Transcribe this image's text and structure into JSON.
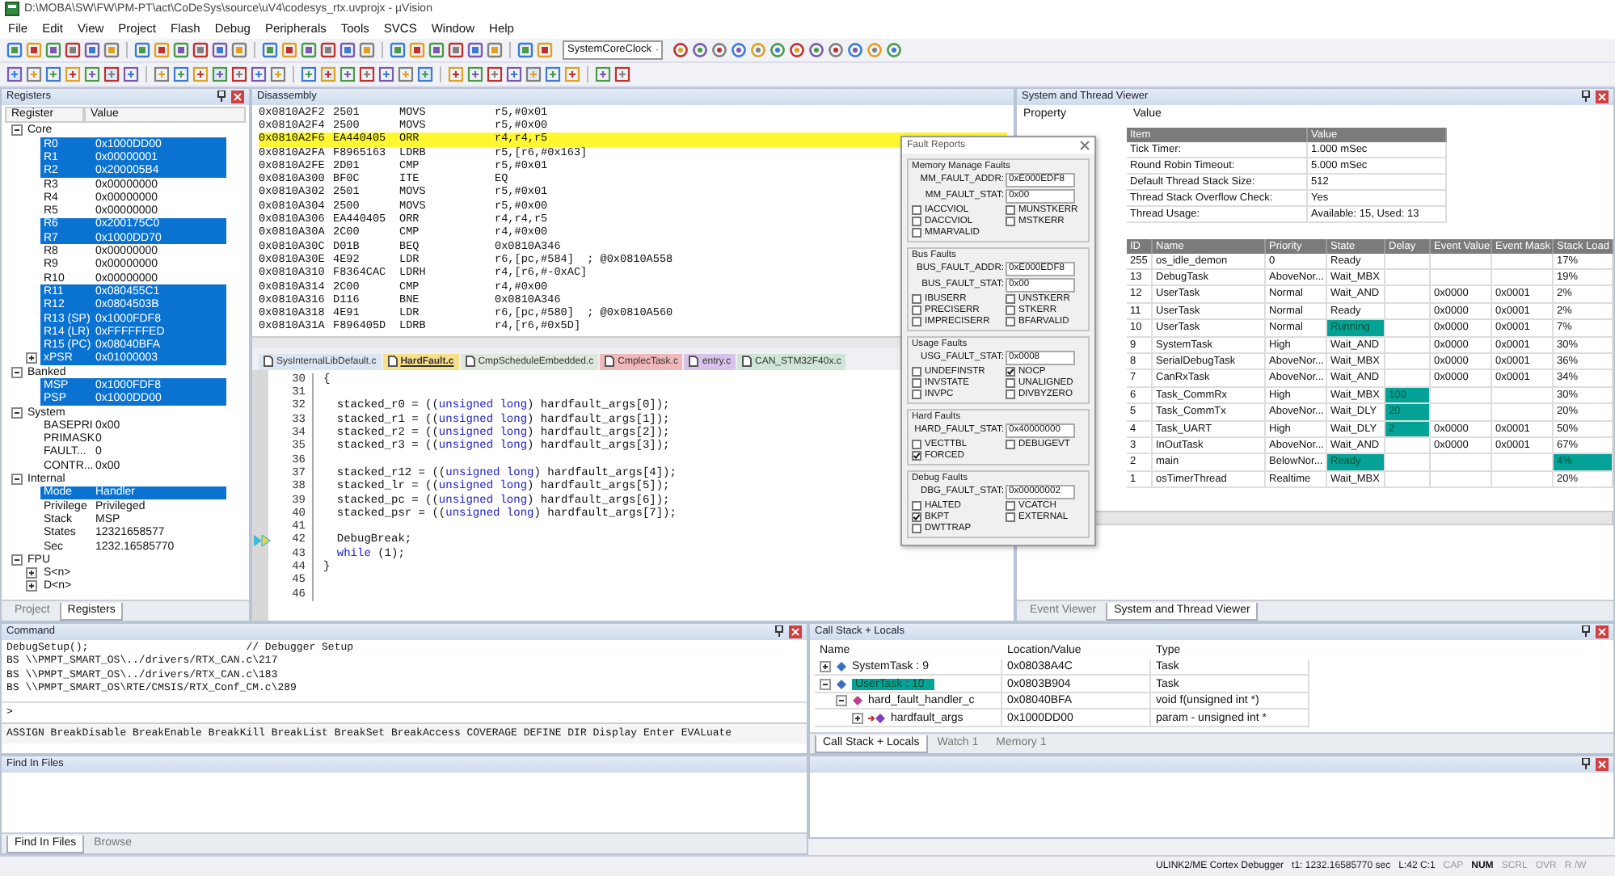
{
  "window": {
    "title": "D:\\MOBA\\SW\\FW\\PM-PT\\act\\CoDeSys\\source\\uV4\\codesys_rtx.uvprojx - µVision"
  },
  "menu": [
    "File",
    "Edit",
    "View",
    "Project",
    "Flash",
    "Debug",
    "Peripherals",
    "Tools",
    "SVCS",
    "Window",
    "Help"
  ],
  "toolbar": {
    "dropdown": "SystemCoreClock"
  },
  "registers": {
    "title": "Registers",
    "columns": [
      "Register",
      "Value"
    ],
    "groups": [
      {
        "name": "Core",
        "expanded": true,
        "items": [
          {
            "name": "R0",
            "value": "0x1000DD00",
            "highlighted": true
          },
          {
            "name": "R1",
            "value": "0x00000001",
            "highlighted": true
          },
          {
            "name": "R2",
            "value": "0x200005B4",
            "highlighted": true
          },
          {
            "name": "R3",
            "value": "0x00000000",
            "highlighted": false
          },
          {
            "name": "R4",
            "value": "0x00000000",
            "highlighted": false
          },
          {
            "name": "R5",
            "value": "0x00000000",
            "highlighted": false
          },
          {
            "name": "R6",
            "value": "0x200175C0",
            "highlighted": true
          },
          {
            "name": "R7",
            "value": "0x1000DD70",
            "highlighted": true
          },
          {
            "name": "R8",
            "value": "0x00000000",
            "highlighted": false
          },
          {
            "name": "R9",
            "value": "0x00000000",
            "highlighted": false
          },
          {
            "name": "R10",
            "value": "0x00000000",
            "highlighted": false
          },
          {
            "name": "R11",
            "value": "0x080455C1",
            "highlighted": true
          },
          {
            "name": "R12",
            "value": "0x0804503B",
            "highlighted": true
          },
          {
            "name": "R13 (SP)",
            "value": "0x1000FDF8",
            "highlighted": true
          },
          {
            "name": "R14 (LR)",
            "value": "0xFFFFFFED",
            "highlighted": true
          },
          {
            "name": "R15 (PC)",
            "value": "0x08040BFA",
            "highlighted": true
          },
          {
            "name": "xPSR",
            "value": "0x01000003",
            "highlighted": true,
            "expanded": false
          }
        ]
      },
      {
        "name": "Banked",
        "expanded": true,
        "items": [
          {
            "name": "MSP",
            "value": "0x1000FDF8",
            "highlighted": true
          },
          {
            "name": "PSP",
            "value": "0x1000DD00",
            "highlighted": true
          }
        ]
      },
      {
        "name": "System",
        "expanded": true,
        "items": [
          {
            "name": "BASEPRI",
            "value": "0x00",
            "highlighted": false
          },
          {
            "name": "PRIMASK",
            "value": "0",
            "highlighted": false
          },
          {
            "name": "FAULT...",
            "value": "0",
            "highlighted": false
          },
          {
            "name": "CONTR...",
            "value": "0x00",
            "highlighted": false
          }
        ]
      },
      {
        "name": "Internal",
        "expanded": true,
        "items": [
          {
            "name": "Mode",
            "value": "Handler",
            "highlighted": true
          },
          {
            "name": "Privilege",
            "value": "Privileged",
            "highlighted": false
          },
          {
            "name": "Stack",
            "value": "MSP",
            "highlighted": false
          },
          {
            "name": "States",
            "value": "12321658577",
            "highlighted": false
          },
          {
            "name": "Sec",
            "value": "1232.16585770",
            "highlighted": false
          }
        ]
      },
      {
        "name": "FPU",
        "expanded": true,
        "items": [
          {
            "name": "S<n>",
            "highlighted": false,
            "expanded": false
          },
          {
            "name": "D<n>",
            "highlighted": false,
            "expanded": false
          }
        ]
      }
    ],
    "tabs": [
      {
        "label": "Project",
        "selected": false
      },
      {
        "label": "Registers",
        "selected": true
      }
    ]
  },
  "disassembly": {
    "title": "Disassembly",
    "rows": [
      {
        "address": "0x0810A2F2",
        "opcode": "2501",
        "mnemonic": "MOVS",
        "operands": "r5,#0x01",
        "current": false
      },
      {
        "address": "0x0810A2F4",
        "opcode": "2500",
        "mnemonic": "MOVS",
        "operands": "r5,#0x00",
        "current": false
      },
      {
        "address": "0x0810A2F6",
        "opcode": "EA440405",
        "mnemonic": "ORR",
        "operands": "r4,r4,r5",
        "current": true
      },
      {
        "address": "0x0810A2FA",
        "opcode": "F8965163",
        "mnemonic": "LDRB",
        "operands": "r5,[r6,#0x163]",
        "current": false
      },
      {
        "address": "0x0810A2FE",
        "opcode": "2D01",
        "mnemonic": "CMP",
        "operands": "r5,#0x01",
        "current": false
      },
      {
        "address": "0x0810A300",
        "opcode": "BF0C",
        "mnemonic": "ITE",
        "operands": "EQ",
        "current": false
      },
      {
        "address": "0x0810A302",
        "opcode": "2501",
        "mnemonic": "MOVS",
        "operands": "r5,#0x01",
        "current": false
      },
      {
        "address": "0x0810A304",
        "opcode": "2500",
        "mnemonic": "MOVS",
        "operands": "r5,#0x00",
        "current": false
      },
      {
        "address": "0x0810A306",
        "opcode": "EA440405",
        "mnemonic": "ORR",
        "operands": "r4,r4,r5",
        "current": false
      },
      {
        "address": "0x0810A30A",
        "opcode": "2C00",
        "mnemonic": "CMP",
        "operands": "r4,#0x00",
        "current": false
      },
      {
        "address": "0x0810A30C",
        "opcode": "D01B",
        "mnemonic": "BEQ",
        "operands": "0x0810A346",
        "current": false
      },
      {
        "address": "0x0810A30E",
        "opcode": "4E92",
        "mnemonic": "LDR",
        "operands": "r6,[pc,#584]  ; @0x0810A558",
        "current": false
      },
      {
        "address": "0x0810A310",
        "opcode": "F8364CAC",
        "mnemonic": "LDRH",
        "operands": "r4,[r6,#-0xAC]",
        "current": false
      },
      {
        "address": "0x0810A314",
        "opcode": "2C00",
        "mnemonic": "CMP",
        "operands": "r4,#0x00",
        "current": false
      },
      {
        "address": "0x0810A316",
        "opcode": "D116",
        "mnemonic": "BNE",
        "operands": "0x0810A346",
        "current": false
      },
      {
        "address": "0x0810A318",
        "opcode": "4E91",
        "mnemonic": "LDR",
        "operands": "r6,[pc,#580]  ; @0x0810A560",
        "current": false
      },
      {
        "address": "0x0810A31A",
        "opcode": "F896405D",
        "mnemonic": "LDRB",
        "operands": "r4,[r6,#0x5D]",
        "current": false
      }
    ]
  },
  "editor": {
    "tabs": [
      {
        "label": "SysInternalLibDefault.c",
        "selected": false,
        "color": "#dce6f2"
      },
      {
        "label": "HardFault.c",
        "selected": true,
        "color": "#f7e08a"
      },
      {
        "label": "CmpScheduleEmbedded.c",
        "selected": false,
        "color": "#dfe8dc"
      },
      {
        "label": "CmplecTask.c",
        "selected": false,
        "color": "#f2b8b8"
      },
      {
        "label": "entry.c",
        "selected": false,
        "color": "#d7c3ea"
      },
      {
        "label": "CAN_STM32F40x.c",
        "selected": false,
        "color": "#cfe5d6"
      }
    ],
    "lines": [
      {
        "number": "30",
        "current": false,
        "parts": [
          {
            "text": "{",
            "kind": "plain"
          }
        ]
      },
      {
        "number": "31",
        "current": false
      },
      {
        "number": "32",
        "current": false,
        "parts": [
          {
            "text": "  stacked_r0 = ((",
            "kind": "plain"
          },
          {
            "text": "unsigned long",
            "kind": "keyword"
          },
          {
            "text": ") hardfault_args[0]);",
            "kind": "plain"
          }
        ]
      },
      {
        "number": "33",
        "current": false,
        "parts": [
          {
            "text": "  stacked_r1 = ((",
            "kind": "plain"
          },
          {
            "text": "unsigned long",
            "kind": "keyword"
          },
          {
            "text": ") hardfault_args[1]);",
            "kind": "plain"
          }
        ]
      },
      {
        "number": "34",
        "current": false,
        "parts": [
          {
            "text": "  stacked_r2 = ((",
            "kind": "plain"
          },
          {
            "text": "unsigned long",
            "kind": "keyword"
          },
          {
            "text": ") hardfault_args[2]);",
            "kind": "plain"
          }
        ]
      },
      {
        "number": "35",
        "current": false,
        "parts": [
          {
            "text": "  stacked_r3 = ((",
            "kind": "plain"
          },
          {
            "text": "unsigned long",
            "kind": "keyword"
          },
          {
            "text": ") hardfault_args[3]);",
            "kind": "plain"
          }
        ]
      },
      {
        "number": "36",
        "current": false
      },
      {
        "number": "37",
        "current": false,
        "parts": [
          {
            "text": "  stacked_r12 = ((",
            "kind": "plain"
          },
          {
            "text": "unsigned long",
            "kind": "keyword"
          },
          {
            "text": ") hardfault_args[4]);",
            "kind": "plain"
          }
        ]
      },
      {
        "number": "38",
        "current": false,
        "parts": [
          {
            "text": "  stacked_lr = ((",
            "kind": "plain"
          },
          {
            "text": "unsigned long",
            "kind": "keyword"
          },
          {
            "text": ") hardfault_args[5]);",
            "kind": "plain"
          }
        ]
      },
      {
        "number": "39",
        "current": false,
        "parts": [
          {
            "text": "  stacked_pc = ((",
            "kind": "plain"
          },
          {
            "text": "unsigned long",
            "kind": "keyword"
          },
          {
            "text": ") hardfault_args[6]);",
            "kind": "plain"
          }
        ]
      },
      {
        "number": "40",
        "current": false,
        "parts": [
          {
            "text": "  stacked_psr = ((",
            "kind": "plain"
          },
          {
            "text": "unsigned long",
            "kind": "keyword"
          },
          {
            "text": ") hardfault_args[7]);",
            "kind": "plain"
          }
        ]
      },
      {
        "number": "41",
        "current": false
      },
      {
        "number": "42",
        "current": true,
        "parts": [
          {
            "text": "  DebugBreak;",
            "kind": "plain"
          }
        ]
      },
      {
        "number": "43",
        "current": false,
        "parts": [
          {
            "text": "  while",
            "kind": "keyword"
          },
          {
            "text": " (1);",
            "kind": "plain"
          }
        ]
      },
      {
        "number": "44",
        "current": false,
        "parts": [
          {
            "text": "}",
            "kind": "plain"
          }
        ]
      },
      {
        "number": "45",
        "current": false
      },
      {
        "number": "46",
        "current": false
      }
    ]
  },
  "fault_reports": {
    "title": "Fault Reports",
    "groups": [
      {
        "name": "Memory Manage Faults",
        "fields": [
          {
            "label": "MM_FAULT_ADDR:",
            "value": "0xE000EDF8"
          },
          {
            "label": "MM_FAULT_STAT:",
            "value": "0x00"
          }
        ],
        "flags": [
          {
            "label": "IACCVIOL",
            "checked": false
          },
          {
            "label": "MUNSTKERR",
            "checked": false
          },
          {
            "label": "DACCVIOL",
            "checked": false
          },
          {
            "label": "MSTKERR",
            "checked": false
          },
          {
            "label": "MMARVALID",
            "checked": false
          }
        ]
      },
      {
        "name": "Bus Faults",
        "fields": [
          {
            "label": "BUS_FAULT_ADDR:",
            "value": "0xE000EDF8"
          },
          {
            "label": "BUS_FAULT_STAT:",
            "value": "0x00"
          }
        ],
        "flags": [
          {
            "label": "IBUSERR",
            "checked": false
          },
          {
            "label": "UNSTKERR",
            "checked": false
          },
          {
            "label": "PRECISERR",
            "checked": false
          },
          {
            "label": "STKERR",
            "checked": false
          },
          {
            "label": "IMPRECISERR",
            "checked": false
          },
          {
            "label": "BFARVALID",
            "checked": false
          }
        ]
      },
      {
        "name": "Usage Faults",
        "fields": [
          {
            "label": "USG_FAULT_STAT:",
            "value": "0x0008"
          }
        ],
        "flags": [
          {
            "label": "UNDEFINSTR",
            "checked": false
          },
          {
            "label": "NOCP",
            "checked": true
          },
          {
            "label": "INVSTATE",
            "checked": false
          },
          {
            "label": "UNALIGNED",
            "checked": false
          },
          {
            "label": "INVPC",
            "checked": false
          },
          {
            "label": "DIVBYZERO",
            "checked": false
          }
        ]
      },
      {
        "name": "Hard Faults",
        "fields": [
          {
            "label": "HARD_FAULT_STAT:",
            "value": "0x40000000"
          }
        ],
        "flags": [
          {
            "label": "VECTTBL",
            "checked": false
          },
          {
            "label": "DEBUGEVT",
            "checked": false
          },
          {
            "label": "FORCED",
            "checked": true
          }
        ]
      },
      {
        "name": "Debug Faults",
        "fields": [
          {
            "label": "DBG_FAULT_STAT:",
            "value": "0x00000002"
          }
        ],
        "flags": [
          {
            "label": "HALTED",
            "checked": false
          },
          {
            "label": "VCATCH",
            "checked": false
          },
          {
            "label": "BKPT",
            "checked": true
          },
          {
            "label": "EXTERNAL",
            "checked": false
          },
          {
            "label": "DWTTRAP",
            "checked": false
          }
        ]
      }
    ]
  },
  "thread_viewer": {
    "title": "System and Thread Viewer",
    "columns": [
      "Property",
      "Value"
    ],
    "summary": {
      "columns": [
        "Item",
        "Value"
      ],
      "rows": [
        {
          "item": "Tick Timer:",
          "value": "1.000 mSec"
        },
        {
          "item": "Round Robin Timeout:",
          "value": "5.000 mSec"
        },
        {
          "item": "Default Thread Stack Size:",
          "value": "512"
        },
        {
          "item": "Thread Stack Overflow Check:",
          "value": "Yes"
        },
        {
          "item": "Thread Usage:",
          "value": "Available: 15, Used: 13"
        }
      ]
    },
    "threads": {
      "columns": [
        "ID",
        "Name",
        "Priority",
        "State",
        "Delay",
        "Event Value",
        "Event Mask",
        "Stack Load"
      ],
      "rows": [
        {
          "id": "255",
          "name": "os_idle_demon",
          "priority": "0",
          "state": "Ready",
          "stack_load": "17%",
          "state_highlight": false,
          "delay_highlight": false,
          "load_highlight": false
        },
        {
          "id": "13",
          "name": "DebugTask",
          "priority": "AboveNor...",
          "state": "Wait_MBX",
          "stack_load": "19%",
          "state_highlight": false,
          "delay_highlight": false,
          "load_highlight": false
        },
        {
          "id": "12",
          "name": "UserTask",
          "priority": "Normal",
          "state": "Wait_AND",
          "event_value": "0x0000",
          "event_mask": "0x0001",
          "stack_load": "2%",
          "state_highlight": false,
          "delay_highlight": false,
          "load_highlight": false
        },
        {
          "id": "11",
          "name": "UserTask",
          "priority": "Normal",
          "state": "Ready",
          "event_value": "0x0000",
          "event_mask": "0x0001",
          "stack_load": "2%",
          "state_highlight": false,
          "delay_highlight": false,
          "load_highlight": false
        },
        {
          "id": "10",
          "name": "UserTask",
          "priority": "Normal",
          "state": "Running",
          "event_value": "0x0000",
          "event_mask": "0x0001",
          "stack_load": "7%",
          "state_highlight": true,
          "delay_highlight": false,
          "load_highlight": false
        },
        {
          "id": "9",
          "name": "SystemTask",
          "priority": "High",
          "state": "Wait_AND",
          "event_value": "0x0000",
          "event_mask": "0x0001",
          "stack_load": "30%",
          "state_highlight": false,
          "delay_highlight": false,
          "load_highlight": false
        },
        {
          "id": "8",
          "name": "SerialDebugTask",
          "priority": "AboveNor...",
          "state": "Wait_MBX",
          "event_value": "0x0000",
          "event_mask": "0x0001",
          "stack_load": "36%",
          "state_highlight": false,
          "delay_highlight": false,
          "load_highlight": false
        },
        {
          "id": "7",
          "name": "CanRxTask",
          "priority": "AboveNor...",
          "state": "Wait_AND",
          "event_value": "0x0000",
          "event_mask": "0x0001",
          "stack_load": "34%",
          "state_highlight": false,
          "delay_highlight": false,
          "load_highlight": false
        },
        {
          "id": "6",
          "name": "Task_CommRx",
          "priority": "High",
          "state": "Wait_MBX",
          "delay": "100",
          "stack_load": "30%",
          "state_highlight": false,
          "delay_highlight": true,
          "load_highlight": false
        },
        {
          "id": "5",
          "name": "Task_CommTx",
          "priority": "AboveNor...",
          "state": "Wait_DLY",
          "delay": "20",
          "stack_load": "20%",
          "state_highlight": false,
          "delay_highlight": true,
          "load_highlight": false
        },
        {
          "id": "4",
          "name": "Task_UART",
          "priority": "High",
          "state": "Wait_DLY",
          "delay": "2",
          "event_value": "0x0000",
          "event_mask": "0x0001",
          "stack_load": "50%",
          "state_highlight": false,
          "delay_highlight": true,
          "load_highlight": false
        },
        {
          "id": "3",
          "name": "InOutTask",
          "priority": "AboveNor...",
          "state": "Wait_AND",
          "event_value": "0x0000",
          "event_mask": "0x0001",
          "stack_load": "67%",
          "state_highlight": false,
          "delay_highlight": false,
          "load_highlight": false
        },
        {
          "id": "2",
          "name": "main",
          "priority": "BelowNor...",
          "state": "Ready",
          "stack_load": "4%",
          "state_highlight": true,
          "delay_highlight": false,
          "load_highlight": true
        },
        {
          "id": "1",
          "name": "osTimerThread",
          "priority": "Realtime",
          "state": "Wait_MBX",
          "stack_load": "20%",
          "state_highlight": false,
          "delay_highlight": false,
          "load_highlight": false
        }
      ]
    },
    "tabs": [
      {
        "label": "Event Viewer",
        "selected": false
      },
      {
        "label": "System and Thread Viewer",
        "selected": true
      }
    ]
  },
  "command": {
    "title": "Command",
    "lines": [
      "DebugSetup();                         // Debugger Setup",
      "BS \\\\PMPT_SMART_OS\\../drivers/RTX_CAN.c\\217",
      "BS \\\\PMPT_SMART_OS\\../drivers/RTX_CAN.c\\183",
      "BS \\\\PMPT_SMART_OS\\RTE/CMSIS/RTX_Conf_CM.c\\289"
    ],
    "prompt": ">",
    "help": "ASSIGN BreakDisable BreakEnable BreakKill BreakList BreakSet BreakAccess COVERAGE DEFINE DIR Display Enter EVALuate"
  },
  "call_stack": {
    "title": "Call Stack + Locals",
    "columns": [
      "Name",
      "Location/Value",
      "Type"
    ],
    "rows": [
      {
        "name": "SystemTask : 9",
        "location": "0x08038A4C",
        "type": "Task",
        "kind": "task",
        "expanded": false,
        "selected": false
      },
      {
        "name": "UserTask : 10",
        "location": "0x0803B904",
        "type": "Task",
        "kind": "task",
        "expanded": true,
        "selected": true,
        "children": [
          {
            "name": "hard_fault_handler_c",
            "location": "0x08040BFA",
            "type": "void f(unsigned int *)",
            "kind": "function",
            "expanded": true,
            "selected": false,
            "children": [
              {
                "name": "hardfault_args",
                "location": "0x1000DD00",
                "type": "param - unsigned int *",
                "kind": "parameter",
                "expanded": false,
                "selected": false
              }
            ]
          }
        ]
      }
    ],
    "tabs": [
      {
        "label": "Call Stack + Locals",
        "selected": true
      },
      {
        "label": "Watch 1",
        "selected": false
      },
      {
        "label": "Memory 1",
        "selected": false
      }
    ]
  },
  "find_in_files": {
    "title": "Find In Files",
    "tabs": [
      {
        "label": "Find In Files",
        "selected": true
      },
      {
        "label": "Browse",
        "selected": false
      }
    ]
  },
  "status_bar": {
    "debugger": "ULINK2/ME Cortex Debugger",
    "time": "t1: 1232.16585770 sec",
    "position": "L:42 C:1",
    "indicators": [
      {
        "label": "CAP",
        "on": false
      },
      {
        "label": "NUM",
        "on": true
      },
      {
        "label": "SCRL",
        "on": false
      },
      {
        "label": "OVR",
        "on": false
      },
      {
        "label": "R /W",
        "on": false
      }
    ]
  }
}
